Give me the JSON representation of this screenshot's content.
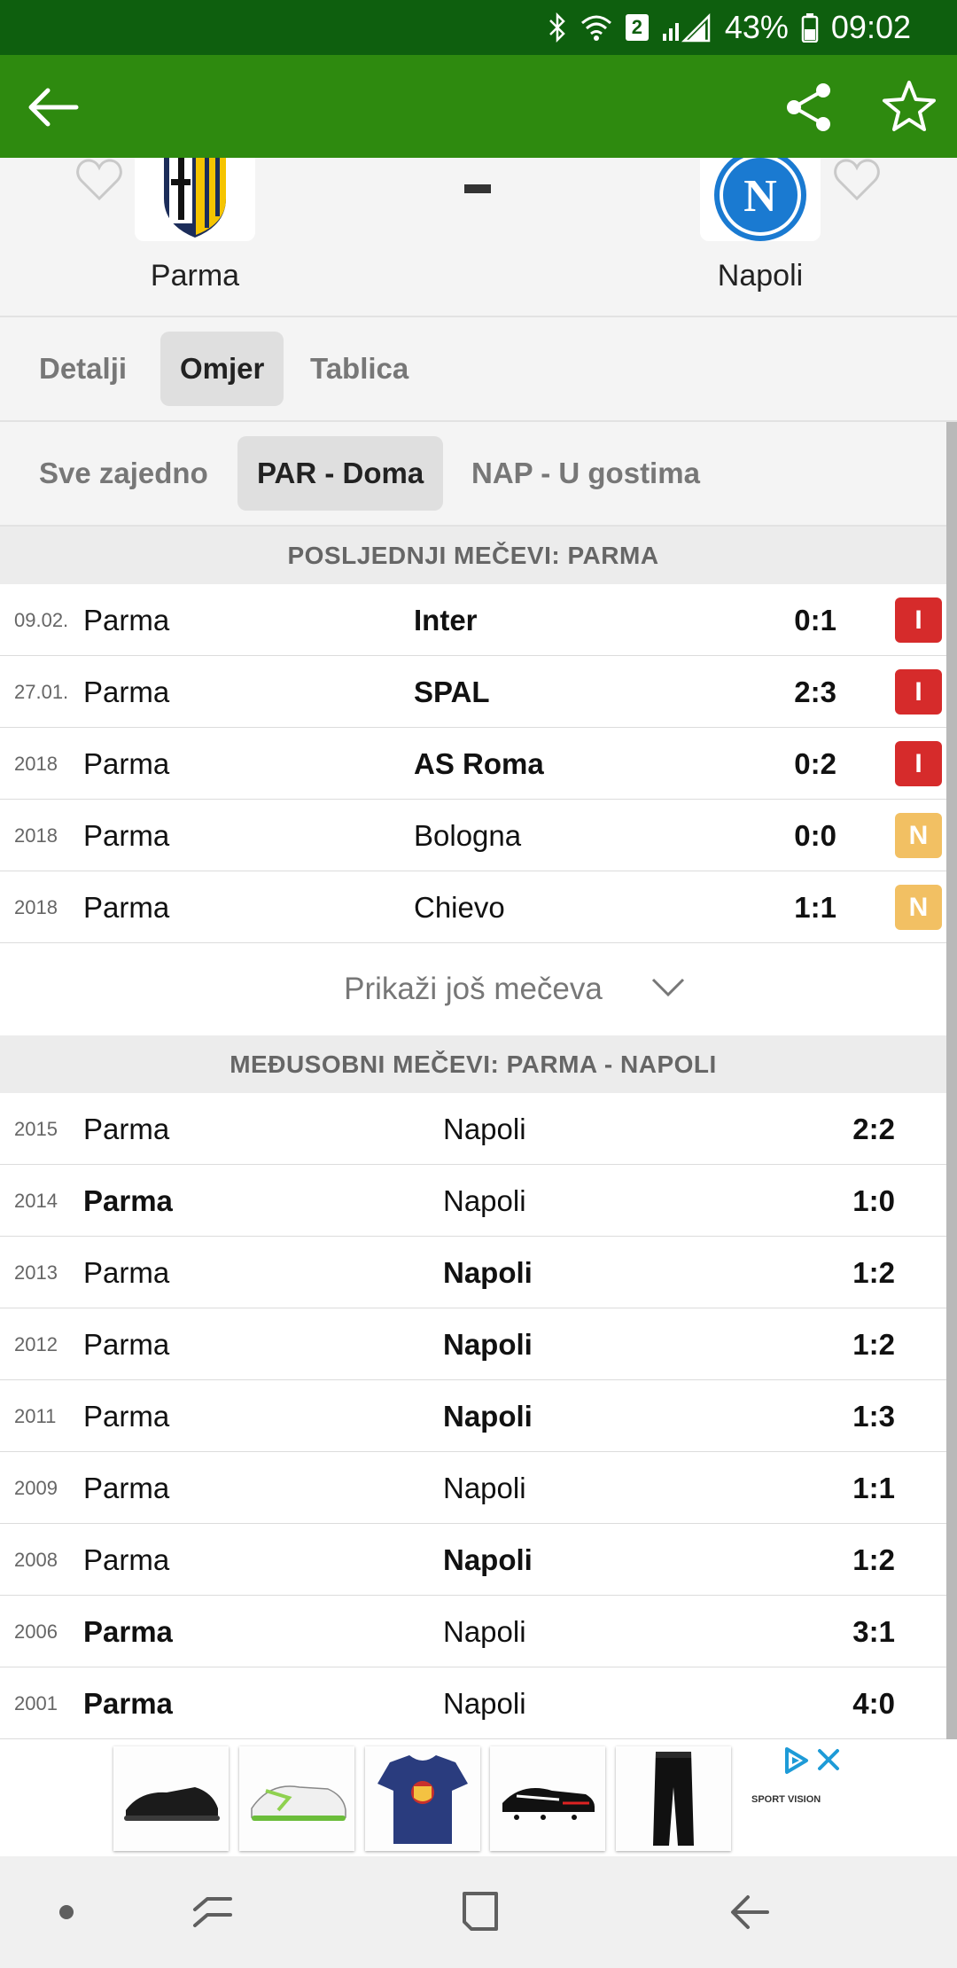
{
  "status_bar": {
    "battery": "43%",
    "time": "09:02",
    "wifi_badge": "2",
    "icons": [
      "bluetooth-icon",
      "wifi-icon",
      "signal-icon",
      "battery-icon"
    ]
  },
  "app_bar": {
    "icons": [
      "back-arrow-icon",
      "share-icon",
      "star-icon"
    ]
  },
  "match": {
    "home_team": "Parma",
    "away_team": "Napoli",
    "napoli_logo_letter": "N",
    "icons": [
      "heart-icon",
      "parma-logo",
      "napoli-logo"
    ]
  },
  "tabs": [
    {
      "label": "Detalji",
      "active": false
    },
    {
      "label": "Omjer",
      "active": true
    },
    {
      "label": "Tablica",
      "active": false
    }
  ],
  "subtabs": [
    {
      "label": "Sve zajedno",
      "active": false
    },
    {
      "label": "PAR - Doma",
      "active": true
    },
    {
      "label": "NAP - U gostima",
      "active": false
    }
  ],
  "last_matches": {
    "title": "POSLJEDNJI MEČEVI: PARMA",
    "rows": [
      {
        "date": "09.02.",
        "home": "Parma",
        "away": "Inter",
        "score": "0:1",
        "result": "I"
      },
      {
        "date": "27.01.",
        "home": "Parma",
        "away": "SPAL",
        "score": "2:3",
        "result": "I"
      },
      {
        "date": "2018",
        "home": "Parma",
        "away": "AS Roma",
        "score": "0:2",
        "result": "I"
      },
      {
        "date": "2018",
        "home": "Parma",
        "away": "Bologna",
        "score": "0:0",
        "result": "N"
      },
      {
        "date": "2018",
        "home": "Parma",
        "away": "Chievo",
        "score": "1:1",
        "result": "N"
      }
    ],
    "result_colors": {
      "I": "#d62b2b",
      "N": "#f2c063"
    },
    "show_more": "Prikaži još mečeva"
  },
  "h2h": {
    "title": "MEĐUSOBNI MEČEVI: PARMA - NAPOLI",
    "rows": [
      {
        "year": "2015",
        "home": "Parma",
        "away": "Napoli",
        "score": "2:2"
      },
      {
        "year": "2014",
        "home": "Parma",
        "away": "Napoli",
        "score": "1:0"
      },
      {
        "year": "2013",
        "home": "Parma",
        "away": "Napoli",
        "score": "1:2"
      },
      {
        "year": "2012",
        "home": "Parma",
        "away": "Napoli",
        "score": "1:2"
      },
      {
        "year": "2011",
        "home": "Parma",
        "away": "Napoli",
        "score": "1:3"
      },
      {
        "year": "2009",
        "home": "Parma",
        "away": "Napoli",
        "score": "1:1"
      },
      {
        "year": "2008",
        "home": "Parma",
        "away": "Napoli",
        "score": "1:2"
      },
      {
        "year": "2006",
        "home": "Parma",
        "away": "Napoli",
        "score": "3:1"
      },
      {
        "year": "2001",
        "home": "Parma",
        "away": "Napoli",
        "score": "4:0"
      }
    ]
  },
  "ad": {
    "brand": "SPORT VISION",
    "items": [
      "running-shoe",
      "indoor-shoe",
      "barcelona-tshirt",
      "football-boot",
      "track-pants"
    ],
    "icons": [
      "adchoices-icon",
      "close-icon"
    ]
  },
  "nav_bar": {
    "icons": [
      "dot-icon",
      "recents-icon",
      "home-icon",
      "back-icon"
    ]
  },
  "colors": {
    "status_bar": "#0e5f0e",
    "app_bar": "#2e8a0f",
    "loss_badge": "#d62b2b",
    "draw_badge": "#f2c063"
  }
}
